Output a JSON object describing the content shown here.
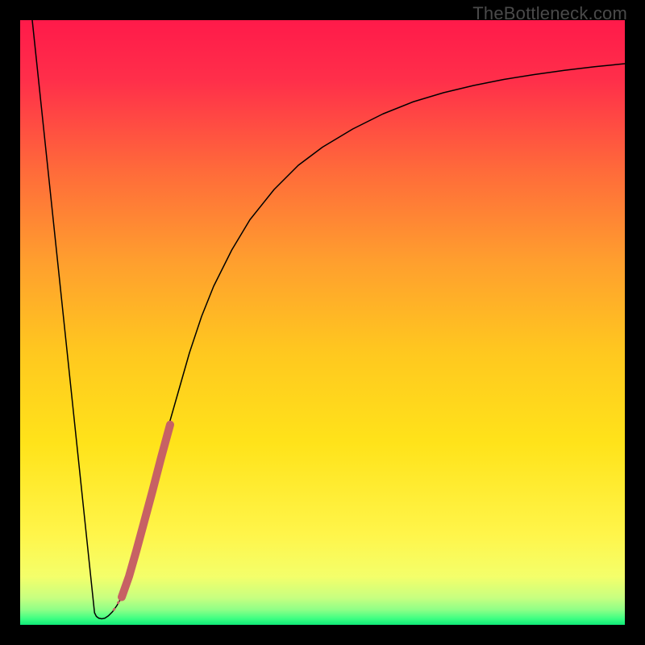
{
  "watermark": "TheBottleneck.com",
  "chart_data": {
    "type": "line",
    "title": "",
    "xlabel": "",
    "ylabel": "",
    "xlim": [
      0,
      100
    ],
    "ylim": [
      0,
      100
    ],
    "series": [
      {
        "name": "left-segment",
        "x": [
          2,
          12.3
        ],
        "y": [
          100,
          2
        ],
        "stroke": "#000000",
        "width": 1.5
      },
      {
        "name": "valley",
        "x": [
          12.3,
          12.6,
          13.0,
          13.5,
          14.0,
          14.6,
          15.3,
          16.0,
          16.8
        ],
        "y": [
          2.0,
          1.4,
          1.1,
          1.0,
          1.1,
          1.5,
          2.2,
          3.2,
          4.6
        ],
        "stroke": "#000000",
        "width": 1.5
      },
      {
        "name": "right-curve",
        "x": [
          16.8,
          18,
          20,
          22,
          24,
          26,
          28,
          30,
          32,
          35,
          38,
          42,
          46,
          50,
          55,
          60,
          65,
          70,
          75,
          80,
          85,
          90,
          95,
          100
        ],
        "y": [
          4.6,
          8,
          15,
          23,
          31,
          38,
          45,
          51,
          56,
          62,
          67,
          72,
          76,
          79,
          82,
          84.5,
          86.5,
          88,
          89.2,
          90.2,
          91,
          91.7,
          92.3,
          92.8
        ],
        "stroke": "#000000",
        "width": 1.5
      },
      {
        "name": "overlay-dotted",
        "x": [
          15.5,
          15.9,
          16.3,
          16.8
        ],
        "y": [
          2.5,
          3.1,
          3.8,
          4.6
        ],
        "stroke": "#c76164",
        "width": 3,
        "dash": "dotted"
      },
      {
        "name": "overlay-thick",
        "x": [
          16.8,
          18.0,
          19.2,
          20.5,
          21.9,
          23.3,
          24.8
        ],
        "y": [
          4.6,
          8.0,
          12.2,
          17.0,
          22.2,
          27.6,
          33.1
        ],
        "stroke": "#c76164",
        "width": 10
      }
    ],
    "background_gradient": {
      "stops": [
        {
          "offset": 0.0,
          "color": "#ff1a4a"
        },
        {
          "offset": 0.1,
          "color": "#ff2f4a"
        },
        {
          "offset": 0.25,
          "color": "#ff6b3a"
        },
        {
          "offset": 0.4,
          "color": "#ff9f2e"
        },
        {
          "offset": 0.55,
          "color": "#ffc81f"
        },
        {
          "offset": 0.7,
          "color": "#ffe31a"
        },
        {
          "offset": 0.85,
          "color": "#fff54a"
        },
        {
          "offset": 0.92,
          "color": "#f4ff6a"
        },
        {
          "offset": 0.955,
          "color": "#c8ff80"
        },
        {
          "offset": 0.975,
          "color": "#8fff87"
        },
        {
          "offset": 0.99,
          "color": "#3cff82"
        },
        {
          "offset": 1.0,
          "color": "#10e878"
        }
      ]
    }
  }
}
